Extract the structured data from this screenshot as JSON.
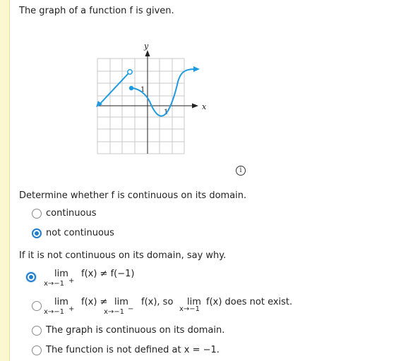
{
  "prompt": "The graph of a function f is given.",
  "graph": {
    "y_label": "y",
    "x_label": "x",
    "y_tick": "1",
    "x_tick": "1",
    "curve_color": "#1e9be0",
    "grid_color": "#c8c8c8"
  },
  "info_icon": "info-icon",
  "question1": {
    "text": "Determine whether f is continuous on its domain.",
    "options": [
      "continuous",
      "not continuous"
    ],
    "selected": 1
  },
  "question2": {
    "text": "If it is not continuous on its domain, say why.",
    "opt1": {
      "lim": "lim",
      "sub": "x→−1",
      "sup": "+",
      "expr": "f(x) ≠ f(−1)"
    },
    "opt2": {
      "lim1": "lim",
      "sub1": "x→−1",
      "sup1": "+",
      "mid": "f(x) ≠",
      "lim2": "lim",
      "sub2": "x→−1",
      "sup2": "−",
      "mid2": "f(x), so",
      "lim3": "lim",
      "sub3": "x→−1",
      "end": "f(x) does not exist."
    },
    "opt3": "The graph is continuous on its domain.",
    "opt4": "The function is not defined at x = −1.",
    "selected": 0
  }
}
